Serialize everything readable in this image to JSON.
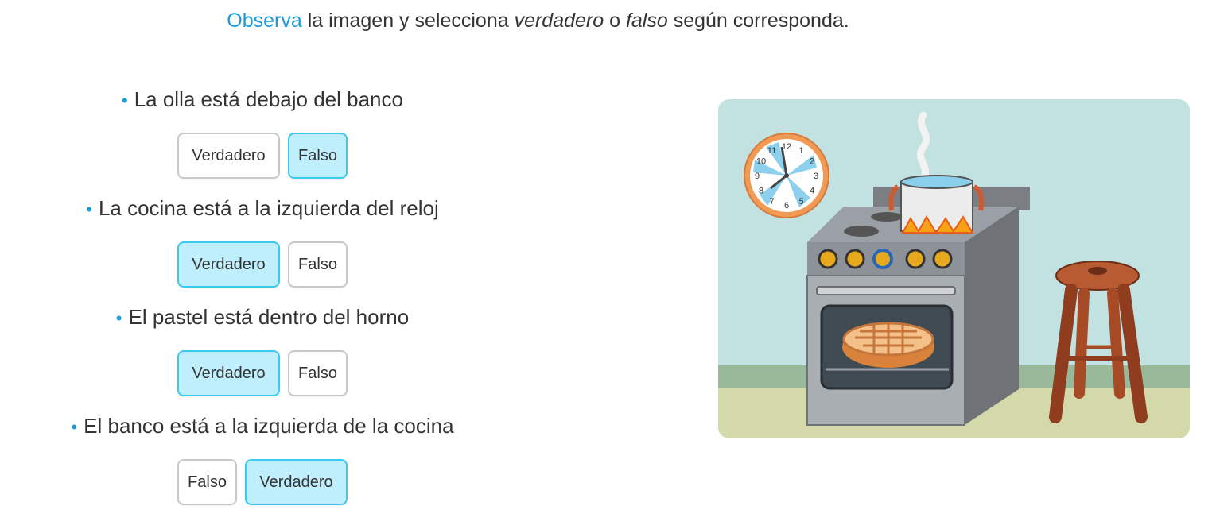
{
  "instruction": {
    "lead": "Observa",
    "t1": " la imagen y selecciona ",
    "em1": "verdadero",
    "t2": " o ",
    "em2": "falso",
    "t3": " según corresponda."
  },
  "questions": [
    {
      "text": "La olla está debajo del banco",
      "options": [
        "Verdadero",
        "Falso"
      ],
      "selected": "Falso"
    },
    {
      "text": "La cocina está a la izquierda del reloj",
      "options": [
        "Verdadero",
        "Falso"
      ],
      "selected": "Verdadero"
    },
    {
      "text": "El pastel está dentro del horno",
      "options": [
        "Verdadero",
        "Falso"
      ],
      "selected": "Verdadero"
    },
    {
      "text": "El banco está a la izquierda de la cocina",
      "options": [
        "Falso",
        "Verdadero"
      ],
      "selected": "Verdadero"
    }
  ],
  "clock_numbers": [
    "12",
    "1",
    "2",
    "3",
    "4",
    "5",
    "6",
    "7",
    "8",
    "9",
    "10",
    "11"
  ],
  "colors": {
    "accent": "#1a9bd8",
    "selected_bg": "#bfeefc",
    "selected_border": "#3bc9ee",
    "wall": "#c2e2e2",
    "floor": "#d3d9a8"
  }
}
